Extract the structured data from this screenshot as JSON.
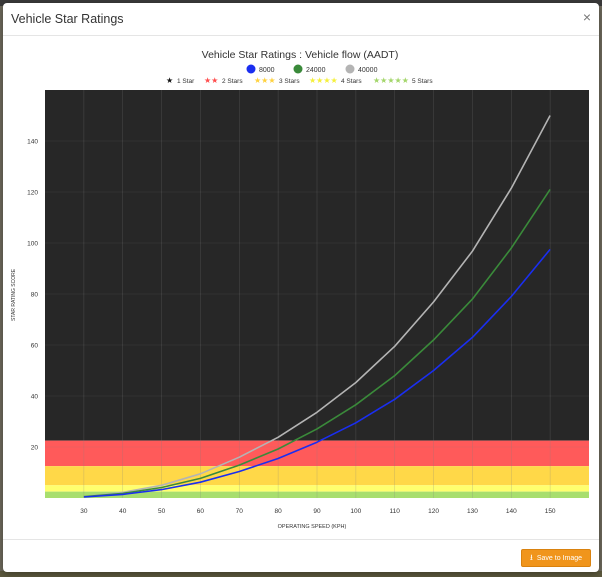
{
  "modal": {
    "title": "Vehicle Star Ratings",
    "close_label": "×",
    "save_label": "Save to Image",
    "save_icon": "download-icon"
  },
  "colors": {
    "plot_bg": "#272727",
    "band_2star": "#ff5a5a",
    "band_3star": "#ffd848",
    "band_4star": "#ffff6e",
    "band_5star": "#a8de6e",
    "series_8000": "#1a2ef0",
    "series_24000": "#3a8a3a",
    "series_40000": "#b4b4b4",
    "button": "#f0951c"
  },
  "chart_data": {
    "type": "line",
    "title": "Vehicle Star Ratings : Vehicle flow (AADT)",
    "xlabel": "OPERATING SPEED (KPH)",
    "ylabel": "STAR RATING SCORE",
    "xlim": [
      20,
      160
    ],
    "ylim": [
      0,
      160
    ],
    "xticks": [
      30,
      40,
      50,
      60,
      70,
      80,
      90,
      100,
      110,
      120,
      130,
      140,
      150
    ],
    "yticks": [
      20,
      40,
      60,
      80,
      100,
      120,
      140
    ],
    "grid": true,
    "legend_position": "top-center",
    "series": [
      {
        "name": "8000",
        "color": "#1a2ef0",
        "x": [
          30,
          40,
          50,
          60,
          70,
          80,
          90,
          100,
          110,
          120,
          130,
          140,
          150
        ],
        "values": [
          0.4,
          1.4,
          3.3,
          6.2,
          10.4,
          15.5,
          21.9,
          29.5,
          38.7,
          50.0,
          63.0,
          79.0,
          97.5
        ]
      },
      {
        "name": "24000",
        "color": "#3a8a3a",
        "x": [
          30,
          40,
          50,
          60,
          70,
          80,
          90,
          100,
          110,
          120,
          130,
          140,
          150
        ],
        "values": [
          0.5,
          1.8,
          4.1,
          7.7,
          12.9,
          19.2,
          27.1,
          36.6,
          48.0,
          62.0,
          78.0,
          98.0,
          121.0
        ]
      },
      {
        "name": "40000",
        "color": "#b4b4b4",
        "x": [
          30,
          40,
          50,
          60,
          70,
          80,
          90,
          100,
          110,
          120,
          130,
          140,
          150
        ],
        "values": [
          0.6,
          2.2,
          5.0,
          9.5,
          16.0,
          23.8,
          33.6,
          45.3,
          59.5,
          76.9,
          96.8,
          121.5,
          150.0
        ]
      }
    ],
    "bands": [
      {
        "name": "1 Star",
        "from": 22.5,
        "to": 160,
        "color": "#272727"
      },
      {
        "name": "2 Stars",
        "from": 12.5,
        "to": 22.5,
        "color": "#ff5a5a"
      },
      {
        "name": "3 Stars",
        "from": 5,
        "to": 12.5,
        "color": "#ffd848"
      },
      {
        "name": "4 Stars",
        "from": 2.5,
        "to": 5,
        "color": "#ffff6e"
      },
      {
        "name": "5 Stars",
        "from": 0,
        "to": 2.5,
        "color": "#a8de6e"
      }
    ],
    "star_legend": [
      {
        "label": "1 Star",
        "stars": 1,
        "color": "#111111"
      },
      {
        "label": "2 Stars",
        "stars": 2,
        "color": "#ff4d4d"
      },
      {
        "label": "3 Stars",
        "stars": 3,
        "color": "#ffd23f"
      },
      {
        "label": "4 Stars",
        "stars": 4,
        "color": "#f5f03a"
      },
      {
        "label": "5 Stars",
        "stars": 5,
        "color": "#a3d66a"
      }
    ]
  }
}
